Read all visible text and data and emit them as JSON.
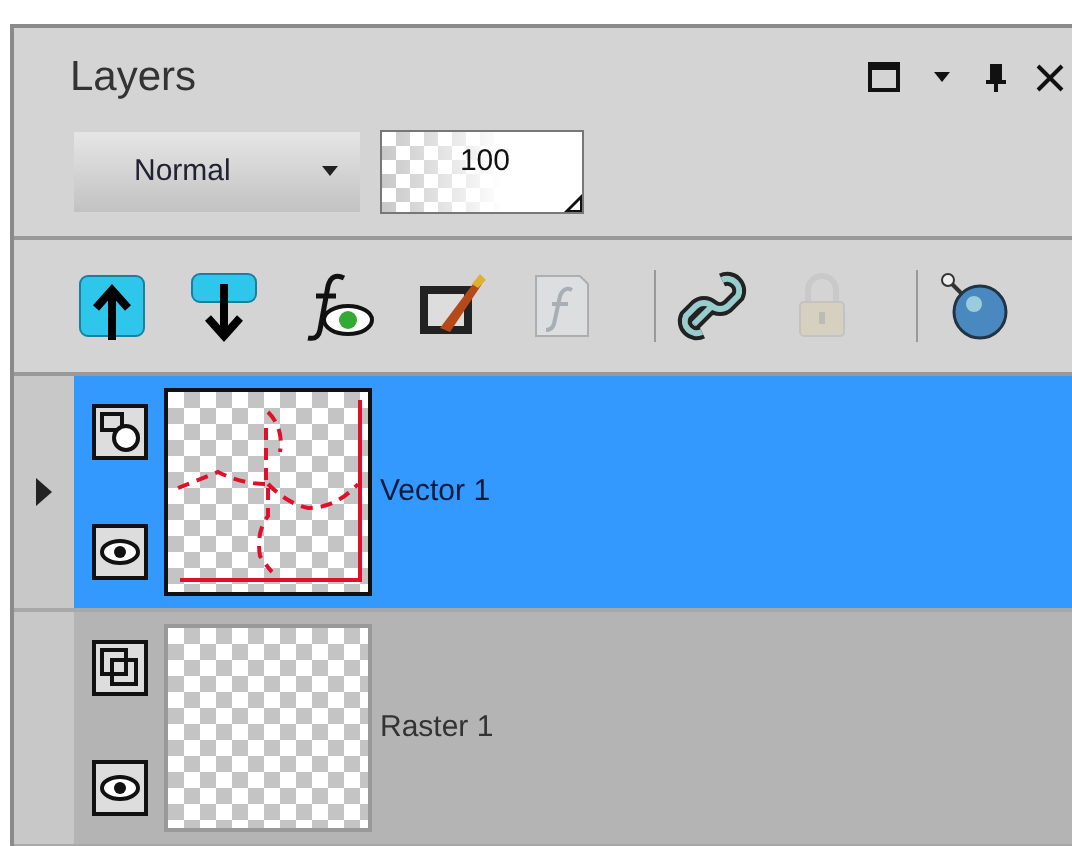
{
  "panel": {
    "title": "Layers"
  },
  "blend_mode": {
    "value": "Normal"
  },
  "opacity": {
    "value": "100"
  },
  "toolbar_groups": [
    [
      {
        "kind": "move-up",
        "disabled": false
      },
      {
        "kind": "move-down",
        "disabled": false
      },
      {
        "kind": "effects-visibility",
        "disabled": false
      },
      {
        "kind": "edit-layer",
        "disabled": false
      },
      {
        "kind": "script",
        "disabled": true
      }
    ],
    [
      {
        "kind": "link",
        "disabled": false
      },
      {
        "kind": "lock",
        "disabled": true
      }
    ],
    [
      {
        "kind": "pin",
        "disabled": false
      }
    ]
  ],
  "layers": [
    {
      "name": "Vector 1",
      "kind": "vector",
      "selected": true,
      "visible": true
    },
    {
      "name": "Raster 1",
      "kind": "raster",
      "selected": false,
      "visible": true
    }
  ]
}
